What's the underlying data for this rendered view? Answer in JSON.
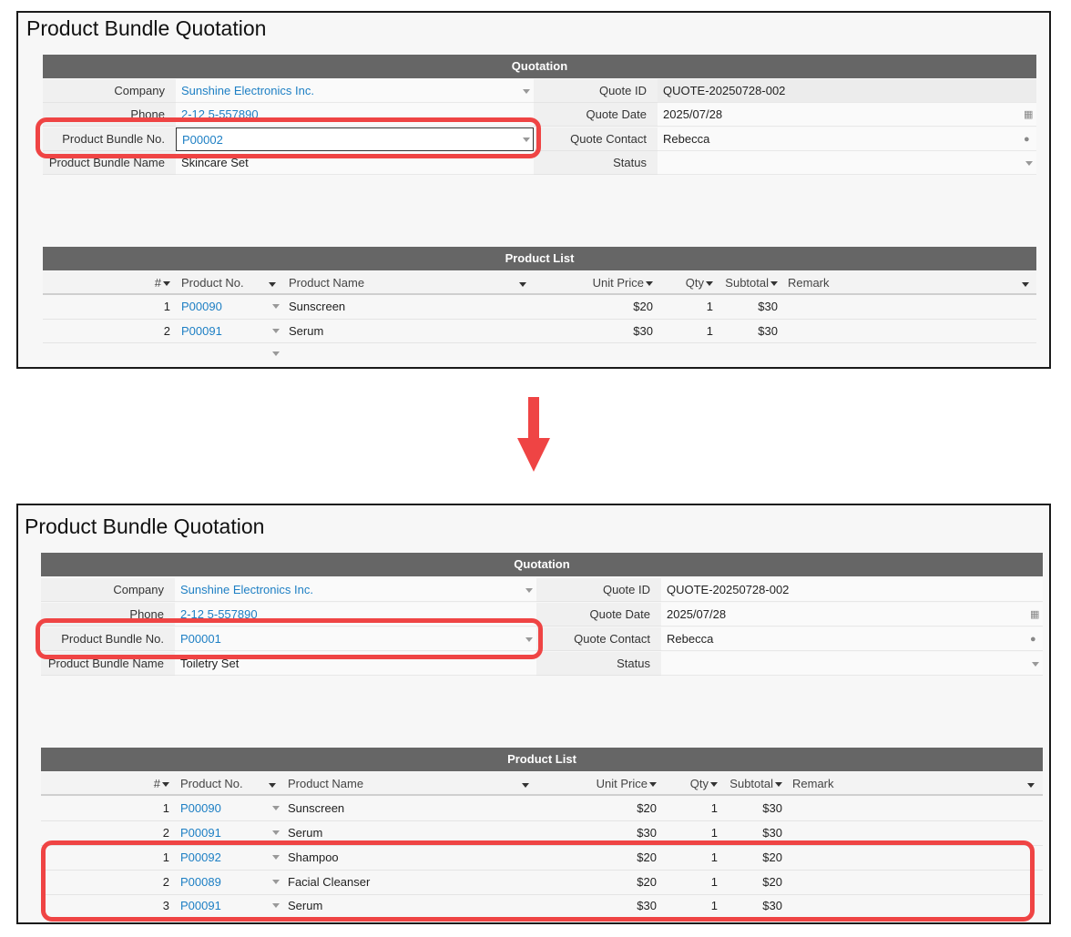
{
  "before": {
    "page_title": "Product Bundle Quotation",
    "quotation_header": "Quotation",
    "labels": {
      "company": "Company",
      "phone": "Phone",
      "bundle_no": "Product Bundle No.",
      "bundle_name": "Product Bundle Name",
      "quote_id": "Quote ID",
      "quote_date": "Quote Date",
      "quote_contact": "Quote Contact",
      "status": "Status"
    },
    "values": {
      "company": "Sunshine Electronics Inc.",
      "phone": "2-12 5-557890",
      "bundle_no": "P00002",
      "bundle_name": "Skincare Set",
      "quote_id": "QUOTE-20250728-002",
      "quote_date": "2025/07/28",
      "quote_contact": "Rebecca",
      "status": ""
    },
    "product_list_header": "Product List",
    "columns": [
      "#",
      "Product No.",
      "Product Name",
      "Unit Price",
      "Qty",
      "Subtotal",
      "Remark"
    ],
    "rows": [
      {
        "num": "1",
        "product_no": "P00090",
        "name": "Sunscreen",
        "unit_price": "$20",
        "qty": "1",
        "subtotal": "$30",
        "remark": ""
      },
      {
        "num": "2",
        "product_no": "P00091",
        "name": "Serum",
        "unit_price": "$30",
        "qty": "1",
        "subtotal": "$30",
        "remark": ""
      }
    ]
  },
  "after": {
    "page_title": "Product Bundle Quotation",
    "quotation_header": "Quotation",
    "labels": {
      "company": "Company",
      "phone": "Phone",
      "bundle_no": "Product Bundle No.",
      "bundle_name": "Product Bundle Name",
      "quote_id": "Quote ID",
      "quote_date": "Quote Date",
      "quote_contact": "Quote Contact",
      "status": "Status"
    },
    "values": {
      "company": "Sunshine Electronics Inc.",
      "phone": "2-12 5-557890",
      "bundle_no": "P00001",
      "bundle_name": "Toiletry Set",
      "quote_id": "QUOTE-20250728-002",
      "quote_date": "2025/07/28",
      "quote_contact": "Rebecca",
      "status": ""
    },
    "product_list_header": "Product List",
    "columns": [
      "#",
      "Product No.",
      "Product Name",
      "Unit Price",
      "Qty",
      "Subtotal",
      "Remark"
    ],
    "rows": [
      {
        "num": "1",
        "product_no": "P00090",
        "name": "Sunscreen",
        "unit_price": "$20",
        "qty": "1",
        "subtotal": "$30",
        "remark": ""
      },
      {
        "num": "2",
        "product_no": "P00091",
        "name": "Serum",
        "unit_price": "$30",
        "qty": "1",
        "subtotal": "$30",
        "remark": ""
      },
      {
        "num": "1",
        "product_no": "P00092",
        "name": "Shampoo",
        "unit_price": "$20",
        "qty": "1",
        "subtotal": "$20",
        "remark": ""
      },
      {
        "num": "2",
        "product_no": "P00089",
        "name": "Facial Cleanser",
        "unit_price": "$20",
        "qty": "1",
        "subtotal": "$20",
        "remark": ""
      },
      {
        "num": "3",
        "product_no": "P00091",
        "name": "Serum",
        "unit_price": "$30",
        "qty": "1",
        "subtotal": "$30",
        "remark": ""
      }
    ]
  },
  "icons": {
    "calendar": "calendar-icon",
    "contact": "person-icon",
    "dropdown": "chevron-down-icon",
    "transition": "arrow-down-icon"
  },
  "colors": {
    "link": "#1d7fc4",
    "highlight": "#ef4444",
    "section_header": "#666666"
  }
}
